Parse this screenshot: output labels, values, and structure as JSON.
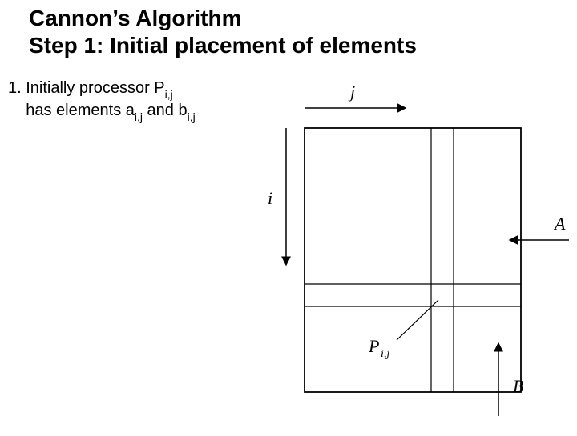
{
  "title_line1": "Cannon’s Algorithm",
  "title_line2": "Step 1: Initial placement of elements",
  "body": {
    "line1_pre": "1. Initially processor P",
    "line1_sub": "i,j",
    "line2_pre": "has elements a",
    "line2_sub1": "i,j",
    "line2_mid": " and b",
    "line2_sub2": "i,j"
  },
  "labels": {
    "i": "i",
    "j": "j",
    "A": "A",
    "B": "B",
    "P": "P",
    "P_sub": "i,j"
  }
}
